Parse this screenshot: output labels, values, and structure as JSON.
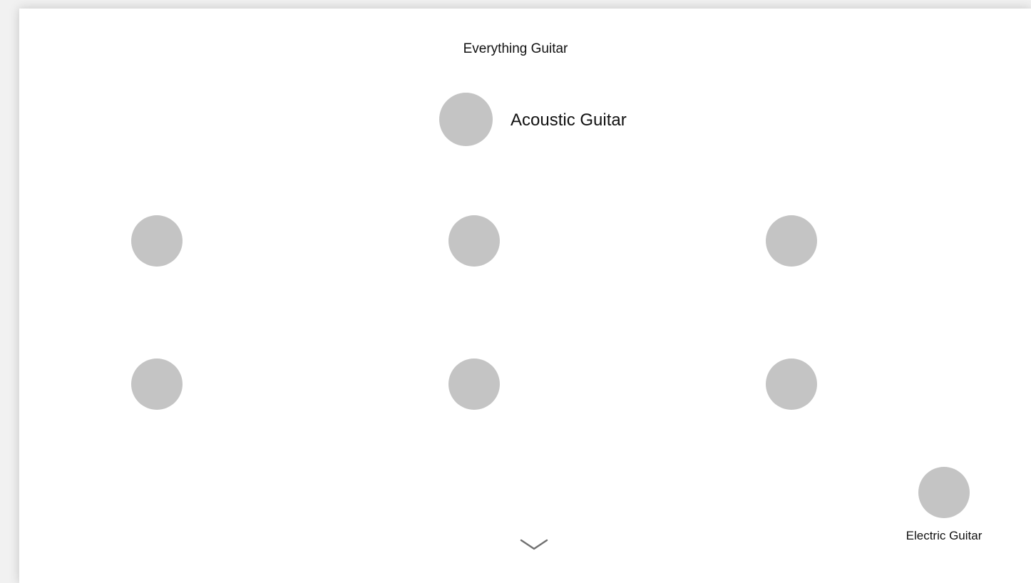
{
  "header": {
    "title": "Everything Guitar"
  },
  "hero": {
    "title": "Acoustic Guitar",
    "icon": "placeholder-circle-icon"
  },
  "grid": {
    "items": [
      {
        "icon": "placeholder-circle-icon"
      },
      {
        "icon": "placeholder-circle-icon"
      },
      {
        "icon": "placeholder-circle-icon"
      },
      {
        "icon": "placeholder-circle-icon"
      },
      {
        "icon": "placeholder-circle-icon"
      },
      {
        "icon": "placeholder-circle-icon"
      }
    ]
  },
  "next_section": {
    "label": "Electric Guitar",
    "icon": "placeholder-circle-icon"
  },
  "scroll": {
    "icon": "chevron-down-icon"
  },
  "colors": {
    "placeholder": "#c4c4c4",
    "background": "#ffffff",
    "text": "#111111",
    "chevron": "#707070"
  }
}
